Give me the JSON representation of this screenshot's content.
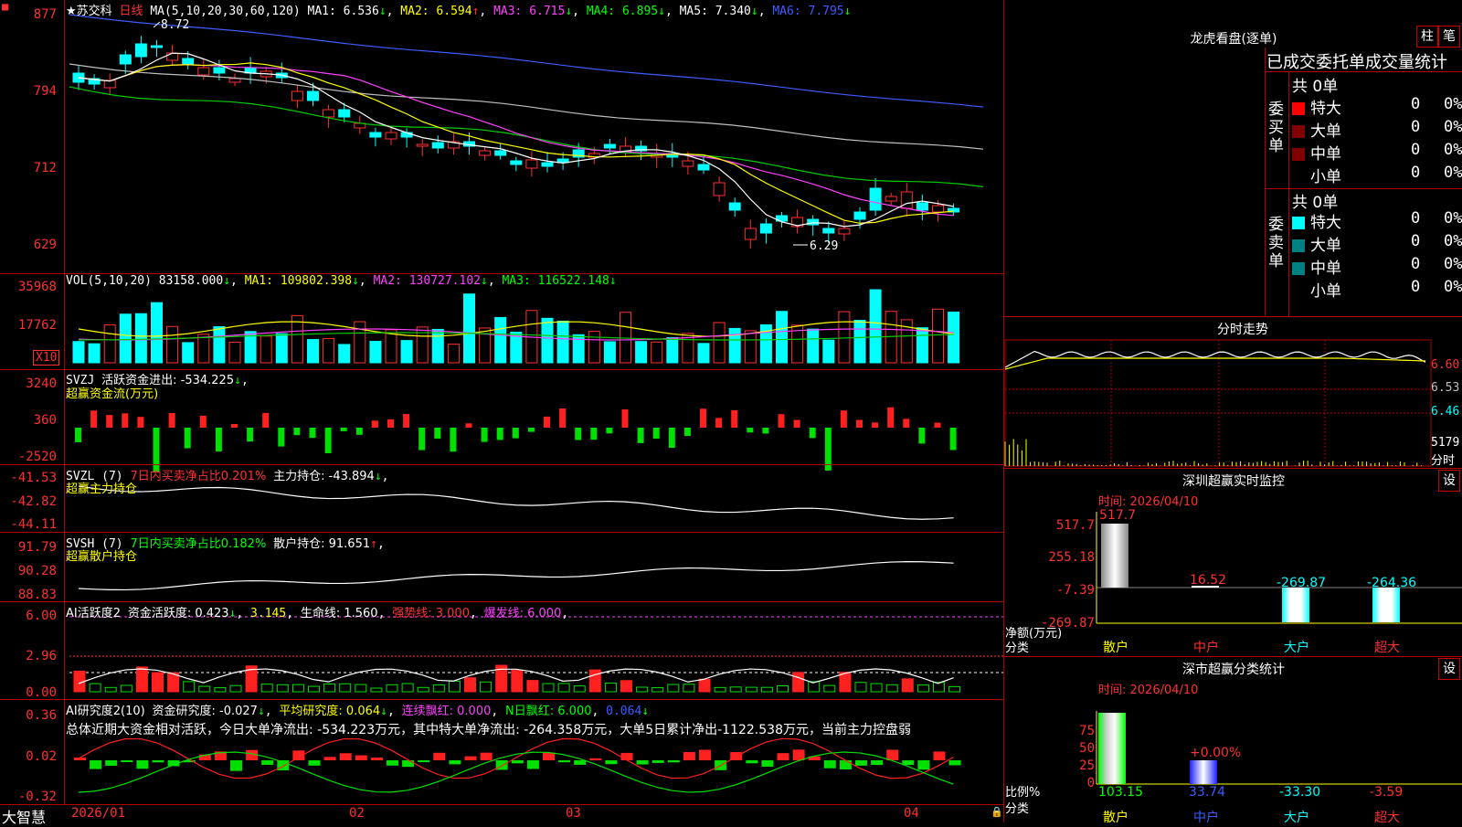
{
  "stock": {
    "name": "★苏交科",
    "period": "日线",
    "peak_label": "8.72",
    "low_label": "6.29"
  },
  "ma": {
    "param": "MA(5,10,20,30,60,120)",
    "ma1": "MA1: 6.536",
    "ma2": "MA2: 6.594",
    "ma3": "MA3: 6.715",
    "ma4": "MA4: 6.895",
    "ma5": "MA5: 7.340",
    "ma6": "MA6: 7.795"
  },
  "price_axis": [
    "877",
    "794",
    "712",
    "629"
  ],
  "vol": {
    "param": "VOL(5,10,20)",
    "value": "83158.000",
    "ma1": "MA1: 109802.398",
    "ma2": "MA2: 130727.102",
    "ma3": "MA3: 116522.148",
    "axis": [
      "35968",
      "17762"
    ],
    "unit": "X10"
  },
  "svzj": {
    "param": "SVZJ",
    "label": "活跃资金进出: -534.225",
    "sub": "超赢资金流(万元)",
    "axis": [
      "3240",
      "360",
      "-2520"
    ]
  },
  "svzl": {
    "param": "SVZL (7)",
    "pct": "7日内买卖净占比0.201%",
    "main": "主力持仓: -43.894",
    "sub": "超赢主力持仓",
    "axis": [
      "-41.53",
      "-42.82",
      "-44.11"
    ]
  },
  "svsh": {
    "param": "SVSH (7)",
    "pct": "7日内买卖净占比0.182%",
    "retail": "散户持仓: 91.651",
    "sub": "超赢散户持仓",
    "axis": [
      "91.79",
      "90.28",
      "88.83"
    ]
  },
  "ai1": {
    "param": "AI活跃度2",
    "act": "资金活跃度: 0.423",
    "v2": "3.145",
    "life": "生命线: 1.560",
    "strong": "强势线: 3.000",
    "burst": "爆发线: 6.000",
    "axis": [
      "6.00",
      "2.96",
      "0.00"
    ]
  },
  "ai2": {
    "param": "AI研究度2(10)",
    "research": "资金研究度: -0.027",
    "avg": "平均研究度: 0.064",
    "cont": "连续飘红: 0.000",
    "nday": "N日飘红: 6.000",
    "v5": "0.064",
    "axis": [
      "0.36",
      "0.02",
      "-0.32"
    ],
    "summary": "总体近期大资金相对活跃，今日大单净流出: -534.223万元，其中特大单净流出: -264.358万元，大单5日累计净出-1122.538万元，当前主力控盘弱"
  },
  "xaxis": [
    "2026/01",
    "02",
    "03",
    "04"
  ],
  "app": {
    "brand": "大智慧"
  },
  "dragon": {
    "title": "龙虎看盘(逐单)",
    "btn1": "柱",
    "btn2": "笔",
    "tabs": "已成交委托单成交量统计",
    "buy_label": "委买单",
    "sell_label": "委卖单",
    "buy_total": "共 0单",
    "sell_total": "共 0单",
    "buy_rows": [
      {
        "name": "特大",
        "count": "0",
        "pct": "0%",
        "color": "#ff0000"
      },
      {
        "name": "大单",
        "count": "0",
        "pct": "0%",
        "color": "#800000"
      },
      {
        "name": "中单",
        "count": "0",
        "pct": "0%",
        "color": "#800000"
      },
      {
        "name": "小单",
        "count": "0",
        "pct": "0%",
        "color": "#000000"
      }
    ],
    "sell_rows": [
      {
        "name": "特大",
        "count": "0",
        "pct": "0%",
        "color": "#00ffff"
      },
      {
        "name": "大单",
        "count": "0",
        "pct": "0%",
        "color": "#008080"
      },
      {
        "name": "中单",
        "count": "0",
        "pct": "0%",
        "color": "#008080"
      },
      {
        "name": "小单",
        "count": "0",
        "pct": "0%",
        "color": "#000000"
      }
    ]
  },
  "intraday": {
    "title": "分时走势",
    "axis": [
      "6.60",
      "6.53",
      "6.46"
    ],
    "vol": "5179",
    "vol_unit": "分时"
  },
  "monitor": {
    "title": "深圳超赢实时监控",
    "set": "设",
    "time": "时间: 2026/04/10",
    "axis": [
      "517.7",
      "255.18",
      "-7.39",
      "-269.87"
    ],
    "ylabel": "净额(万元)",
    "xlabel": "分类",
    "bars": [
      {
        "cat": "散户",
        "value": "517.7"
      },
      {
        "cat": "中户",
        "value": "16.52"
      },
      {
        "cat": "大户",
        "value": "-269.87"
      },
      {
        "cat": "超大",
        "value": "-264.36"
      }
    ]
  },
  "classify": {
    "title": "深市超赢分类统计",
    "set": "设",
    "time": "时间: 2026/04/10",
    "axis": [
      "75",
      "50",
      "25",
      "0"
    ],
    "ylabel": "比例%",
    "xlabel": "分类",
    "bars": [
      {
        "cat": "散户",
        "value": "103.15"
      },
      {
        "cat": "中户",
        "value": "33.74",
        "top": "+0.00%"
      },
      {
        "cat": "大户",
        "value": "-33.30"
      },
      {
        "cat": "超大",
        "value": "-3.59"
      }
    ]
  },
  "chart_data": [
    {
      "type": "candlestick",
      "title": "苏交科 日线",
      "ylim": [
        629,
        877
      ],
      "peak": 8.72,
      "low": 6.29
    },
    {
      "type": "bar",
      "title": "VOL(5,10,20)",
      "ylim": [
        0,
        35968
      ]
    },
    {
      "type": "bar",
      "title": "超赢资金流(万元)",
      "ylim": [
        -2520,
        3240
      ]
    },
    {
      "type": "bar",
      "title": "深圳超赢实时监控",
      "categories": [
        "散户",
        "中户",
        "大户",
        "超大"
      ],
      "values": [
        517.7,
        16.52,
        -269.87,
        -264.36
      ],
      "ylabel": "净额(万元)",
      "xlabel": "分类"
    },
    {
      "type": "bar",
      "title": "深市超赢分类统计",
      "categories": [
        "散户",
        "中户",
        "大户",
        "超大"
      ],
      "values": [
        103.15,
        33.74,
        -33.3,
        -3.59
      ],
      "ylabel": "比例%",
      "xlabel": "分类"
    }
  ]
}
